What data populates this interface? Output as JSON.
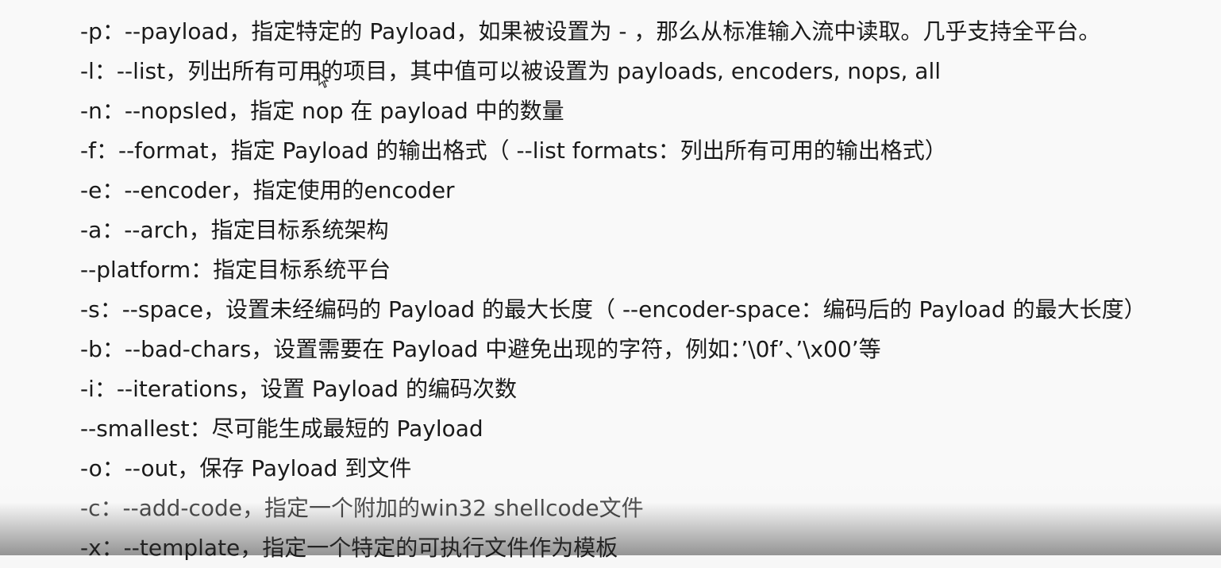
{
  "document": {
    "lines": [
      "-p：--payload，指定特定的 Payload，如果被设置为 - ，那么从标准输入流中读取。几乎支持全平台。",
      "-l：--list，列出所有可用的项目，其中值可以被设置为 payloads, encoders, nops, all",
      "-n：--nopsled，指定 nop 在 payload 中的数量",
      "-f：--format，指定 Payload 的输出格式（ --list formats：列出所有可用的输出格式）",
      "-e：--encoder，指定使用的encoder",
      "-a：--arch，指定目标系统架构",
      "--platform：指定目标系统平台",
      "-s：--space，设置未经编码的 Payload 的最大长度（ --encoder-space：编码后的 Payload 的最大长度）",
      "-b：--bad-chars，设置需要在 Payload 中避免出现的字符，例如：’\\0f’、’\\x00’等",
      "-i：--iterations，设置 Payload 的编码次数",
      "--smallest：尽可能生成最短的 Payload",
      "-o：--out，保存 Payload 到文件",
      "-c：--add-code，指定一个附加的win32 shellcode文件",
      "-x：--template，指定一个特定的可执行文件作为模板"
    ]
  }
}
